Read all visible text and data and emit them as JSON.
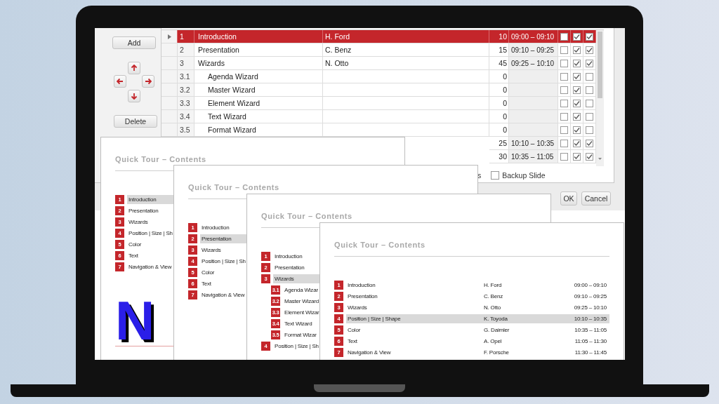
{
  "dialog": {
    "add_button": "Add",
    "delete_button": "Delete",
    "table": {
      "rows": [
        {
          "number": "1",
          "title": "Introduction",
          "speaker": "H. Ford",
          "duration": "10",
          "time": "09:00 – 09:10",
          "checks": [
            false,
            true,
            true
          ],
          "selected": true
        },
        {
          "number": "2",
          "title": "Presentation",
          "speaker": "C. Benz",
          "duration": "15",
          "time": "09:10 – 09:25",
          "checks": [
            false,
            true,
            true
          ],
          "selected": false
        },
        {
          "number": "3",
          "title": "Wizards",
          "speaker": "N. Otto",
          "duration": "45",
          "time": "09:25 – 10:10",
          "checks": [
            false,
            true,
            true
          ],
          "selected": false,
          "children": [
            {
              "number": "3.1",
              "title": "Agenda Wizard",
              "duration": "0",
              "checks": [
                false,
                true,
                false
              ],
              "selected": false
            },
            {
              "number": "3.2",
              "title": "Master Wizard",
              "duration": "0",
              "checks": [
                false,
                true,
                false
              ],
              "selected": false
            },
            {
              "number": "3.3",
              "title": "Element Wizard",
              "duration": "0",
              "checks": [
                false,
                true,
                false
              ],
              "selected": false
            },
            {
              "number": "3.4",
              "title": "Text Wizard",
              "duration": "0",
              "checks": [
                false,
                true,
                false
              ],
              "selected": false
            },
            {
              "number": "3.5",
              "title": "Format Wizard",
              "duration": "0",
              "checks": [
                false,
                true,
                false
              ],
              "selected": false
            }
          ]
        },
        {
          "duration": "25",
          "time": "10:10 – 10:35",
          "checks": [
            false,
            true,
            true
          ],
          "selected": false
        },
        {
          "duration": "30",
          "time": "10:35 – 11:05",
          "checks": [
            false,
            true,
            true
          ],
          "selected": false
        }
      ]
    },
    "partial_label": "s",
    "backup_slide": {
      "label": "Backup Slide",
      "checked": false
    },
    "ok_button": "OK",
    "cancel_button": "Cancel"
  },
  "slides": [
    {
      "title": "Quick Tour – Contents",
      "logo": "N",
      "items": [
        {
          "number": "1",
          "label": "Introduction",
          "selected": true
        },
        {
          "number": "2",
          "label": "Presentation",
          "selected": false
        },
        {
          "number": "3",
          "label": "Wizards",
          "selected": false
        },
        {
          "number": "4",
          "label": "Position | Size | Sh",
          "selected": false
        },
        {
          "number": "5",
          "label": "Color",
          "selected": false
        },
        {
          "number": "6",
          "label": "Text",
          "selected": false
        },
        {
          "number": "7",
          "label": "Navigation & View",
          "selected": false
        }
      ]
    },
    {
      "title": "Quick Tour – Contents",
      "items": [
        {
          "number": "1",
          "label": "Introduction",
          "selected": false
        },
        {
          "number": "2",
          "label": "Presentation",
          "selected": true
        },
        {
          "number": "3",
          "label": "Wizards",
          "selected": false
        },
        {
          "number": "4",
          "label": "Position | Size | Sh",
          "selected": false
        },
        {
          "number": "5",
          "label": "Color",
          "selected": false
        },
        {
          "number": "6",
          "label": "Text",
          "selected": false
        },
        {
          "number": "7",
          "label": "Navigation & View",
          "selected": false
        }
      ]
    },
    {
      "title": "Quick Tour – Contents",
      "items": [
        {
          "number": "1",
          "label": "Introduction",
          "selected": false
        },
        {
          "number": "2",
          "label": "Presentation",
          "selected": false
        },
        {
          "number": "3",
          "label": "Wizards",
          "selected": true,
          "children": [
            {
              "number": "3.1",
              "label": "Agenda Wizar",
              "selected": false
            },
            {
              "number": "3.2",
              "label": "Master Wizard",
              "selected": false
            },
            {
              "number": "3.3",
              "label": "Element Wizar",
              "selected": false
            },
            {
              "number": "3.4",
              "label": "Text Wizard",
              "selected": false
            },
            {
              "number": "3.5",
              "label": "Format Wizar",
              "selected": false
            }
          ]
        },
        {
          "number": "4",
          "label": "Position | Size | Sh",
          "selected": false
        }
      ]
    },
    {
      "title": "Quick Tour – Contents",
      "items": [
        {
          "number": "1",
          "label": "Introduction",
          "speaker": "H. Ford",
          "time": "09:00 – 09:10",
          "selected": false
        },
        {
          "number": "2",
          "label": "Presentation",
          "speaker": "C. Benz",
          "time": "09:10 – 09:25",
          "selected": false
        },
        {
          "number": "3",
          "label": "Wizards",
          "speaker": "N. Otto",
          "time": "09:25 – 10:10",
          "selected": false
        },
        {
          "number": "4",
          "label": "Position | Size | Shape",
          "speaker": "K. Toyoda",
          "time": "10:10 – 10:35",
          "selected": true
        },
        {
          "number": "5",
          "label": "Color",
          "speaker": "G. Daimler",
          "time": "10:35 – 11:05",
          "selected": false
        },
        {
          "number": "6",
          "label": "Text",
          "speaker": "A. Opel",
          "time": "11:05 – 11:30",
          "selected": false
        },
        {
          "number": "7",
          "label": "Navigation & View",
          "speaker": "F. Porsche",
          "time": "11:30 – 11:45",
          "selected": false
        }
      ]
    }
  ]
}
